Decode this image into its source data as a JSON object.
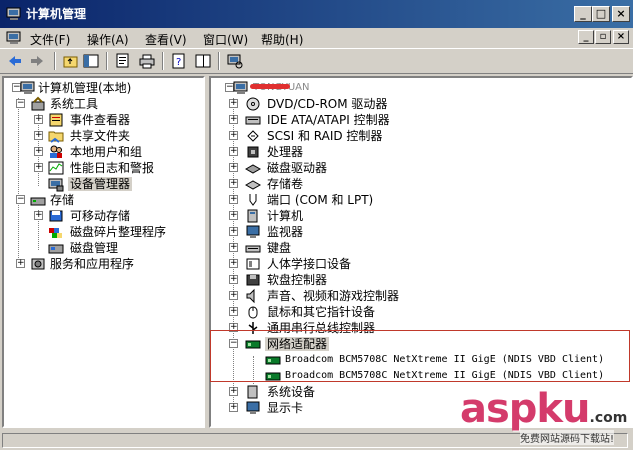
{
  "window": {
    "title": "计算机管理"
  },
  "menubar": {
    "items": [
      {
        "label": "文件(F)"
      },
      {
        "label": "操作(A)"
      },
      {
        "label": "查看(V)"
      },
      {
        "label": "窗口(W)"
      },
      {
        "label": "帮助(H)"
      }
    ]
  },
  "left_tree": [
    {
      "label": "计算机管理(本地)"
    },
    {
      "label": "系统工具"
    },
    {
      "label": "事件查看器"
    },
    {
      "label": "共享文件夹"
    },
    {
      "label": "本地用户和组"
    },
    {
      "label": "性能日志和警报"
    },
    {
      "label": "设备管理器"
    },
    {
      "label": "存储"
    },
    {
      "label": "可移动存储"
    },
    {
      "label": "磁盘碎片整理程序"
    },
    {
      "label": "磁盘管理"
    },
    {
      "label": "服务和应用程序"
    }
  ],
  "device_tree": {
    "root": "TONGYUAN",
    "categories": [
      {
        "label": "DVD/CD-ROM 驱动器"
      },
      {
        "label": "IDE ATA/ATAPI 控制器"
      },
      {
        "label": "SCSI 和 RAID 控制器"
      },
      {
        "label": "处理器"
      },
      {
        "label": "磁盘驱动器"
      },
      {
        "label": "存储卷"
      },
      {
        "label": "端口 (COM 和 LPT)"
      },
      {
        "label": "计算机"
      },
      {
        "label": "监视器"
      },
      {
        "label": "键盘"
      },
      {
        "label": "人体学接口设备"
      },
      {
        "label": "软盘控制器"
      },
      {
        "label": "声音、视频和游戏控制器"
      },
      {
        "label": "鼠标和其它指针设备"
      },
      {
        "label": "通用串行总线控制器"
      },
      {
        "label": "网络适配器"
      },
      {
        "label": "Broadcom BCM5708C NetXtreme II GigE (NDIS VBD Client)"
      },
      {
        "label": "Broadcom BCM5708C NetXtreme II GigE (NDIS VBD Client)"
      },
      {
        "label": "系统设备"
      },
      {
        "label": "显示卡"
      }
    ]
  },
  "watermark": {
    "brand": "aspku",
    "suffix": ".com",
    "sub": "免费网站源码下载站!"
  },
  "colors": {
    "titlebar_start": "#0a246a",
    "titlebar_end": "#3a6ea5",
    "highlight_border": "#c0392b"
  }
}
